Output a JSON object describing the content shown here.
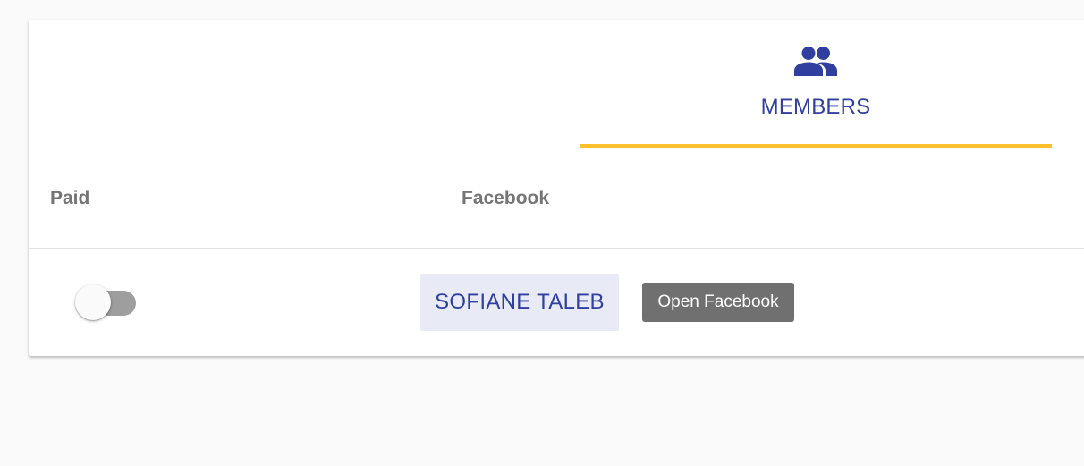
{
  "colors": {
    "accent": "#303f9f",
    "indicator": "#fbc02d",
    "chip_background": "#e8eaf6",
    "button_background": "#707070"
  },
  "tab": {
    "icon": "people-icon",
    "label": "MEMBERS"
  },
  "table": {
    "headers": {
      "paid": "Paid",
      "facebook": "Facebook"
    },
    "rows": [
      {
        "paid": false,
        "name": "SOFIANE TALEB",
        "facebook_button": "Open Facebook"
      }
    ]
  }
}
